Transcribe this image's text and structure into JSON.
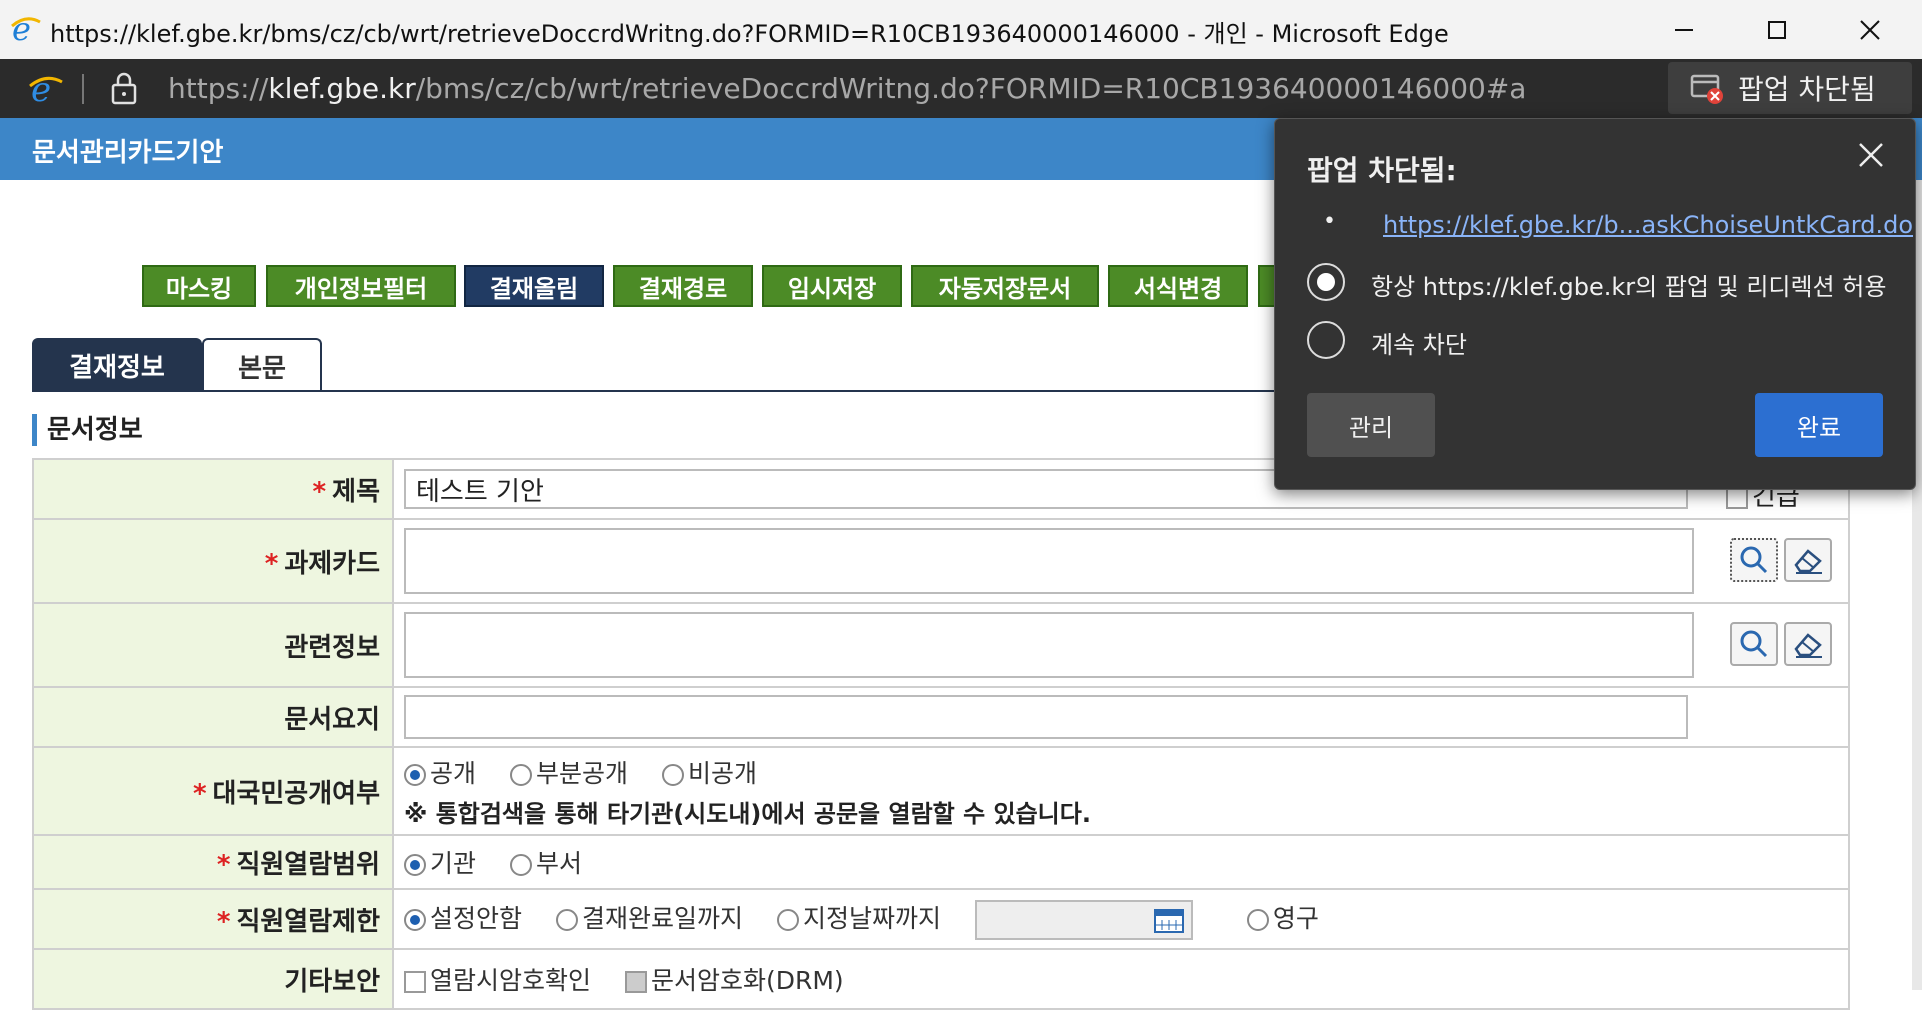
{
  "window": {
    "title": "https://klef.gbe.kr/bms/cz/cb/wrt/retrieveDoccrdWritng.do?FORMID=R10CB193640000146000 - 개인 - Microsoft Edge"
  },
  "address_bar": {
    "url_prefix": "https://",
    "url_host": "klef.gbe.kr",
    "url_path": "/bms/cz/cb/wrt/retrieveDoccrdWritng.do?FORMID=R10CB193640000146000#a",
    "popup_blocked_chip": "팝업 차단됨"
  },
  "page": {
    "title": "문서관리카드기안",
    "buttons": [
      "마스킹",
      "개인정보필터",
      "결재올림",
      "결재경로",
      "임시저장",
      "자동저장문서",
      "서식변경"
    ],
    "tabs": [
      "결재정보",
      "본문"
    ],
    "section_title": "문서정보"
  },
  "form": {
    "title_label": "제목",
    "title_value": "테스트 기안",
    "urgent_label": "긴급",
    "task_card_label": "과제카드",
    "related_info_label": "관련정보",
    "summary_label": "문서요지",
    "public_label": "대국민공개여부",
    "public_options": [
      "공개",
      "부분공개",
      "비공개"
    ],
    "public_notice": "※ 통합검색을 통해 타기관(시도내)에서 공문을 열람할 수 있습니다.",
    "read_scope_label": "직원열람범위",
    "read_scope_options": [
      "기관",
      "부서"
    ],
    "read_limit_label": "직원열람제한",
    "read_limit_options": [
      "설정안함",
      "결재완료일까지",
      "지정날짜까지"
    ],
    "read_limit_forever": "영구",
    "etc_security_label": "기타보안",
    "etc_options": [
      "열람시암호확인",
      "문서암호화(DRM)"
    ]
  },
  "flyout": {
    "title": "팝업 차단됨:",
    "bullet": "•",
    "link": "https://klef.gbe.kr/b...askChoiseUntkCard.do",
    "option_allow": "항상 https://klef.gbe.kr의 팝업 및 리디렉션 허용",
    "option_block": "계속 차단",
    "manage_button": "관리",
    "done_button": "완료"
  },
  "colors": {
    "header_blue": "#3d86c8",
    "button_green": "#4c8b26",
    "button_navy": "#213b63",
    "flyout_bg": "#333333",
    "done_blue": "#2c6fd1"
  }
}
